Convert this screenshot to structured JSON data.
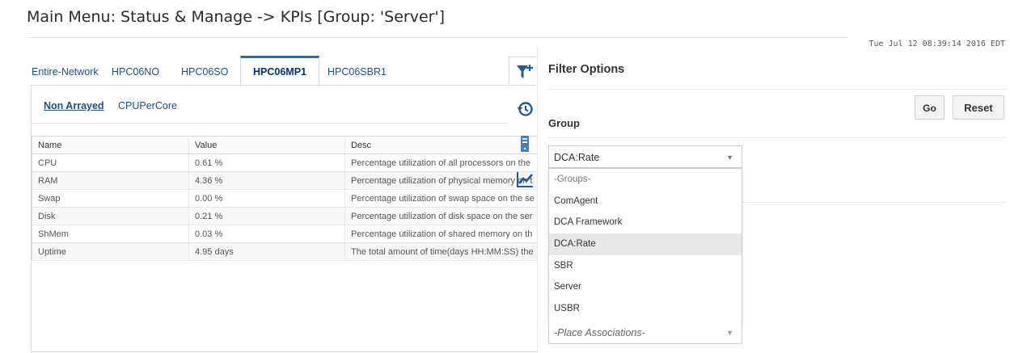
{
  "page": {
    "title": "Main Menu: Status & Manage -> KPIs [Group: 'Server']",
    "timestamp": "Tue Jul 12 08:39:14 2016 EDT"
  },
  "tabs": [
    {
      "label": "Entire-Network"
    },
    {
      "label": "HPC06NO"
    },
    {
      "label": "HPC06SO"
    },
    {
      "label": "HPC06MP1",
      "active": true
    },
    {
      "label": "HPC06SBR1"
    }
  ],
  "subtabs": [
    {
      "label": "Non Arrayed",
      "active": true
    },
    {
      "label": "CPUPerCore"
    }
  ],
  "table": {
    "columns": [
      "Name",
      "Value",
      "Desc"
    ],
    "rows": [
      [
        "CPU",
        "0.61 %",
        "Percentage utilization of all processors on the"
      ],
      [
        "RAM",
        "4.36 %",
        "Percentage utilization of physical memory on t"
      ],
      [
        "Swap",
        "0.00 %",
        "Percentage utilization of swap space on the se"
      ],
      [
        "Disk",
        "0.21 %",
        "Percentage utilization of disk space on the ser"
      ],
      [
        "ShMem",
        "0.03 %",
        "Percentage utilization of shared memory on th"
      ],
      [
        "Uptime",
        "4.95 days",
        "The total amount of time(days HH:MM:SS) the"
      ]
    ]
  },
  "side_icons": [
    "filter-add-icon",
    "history-icon",
    "server-icon",
    "chart-icon"
  ],
  "filter": {
    "title": "Filter Options",
    "go_label": "Go",
    "reset_label": "Reset",
    "group_label": "Group",
    "group_selected": "DCA:Rate",
    "group_options": [
      "-Groups-",
      "ComAgent",
      "DCA Framework",
      "DCA:Rate",
      "SBR",
      "Server",
      "USBR"
    ],
    "hovered_option": "DCA:Rate",
    "associations_placeholder": "-Place Associations-"
  },
  "colors": {
    "accent": "#1f6fb5",
    "link": "#1f4f86"
  }
}
